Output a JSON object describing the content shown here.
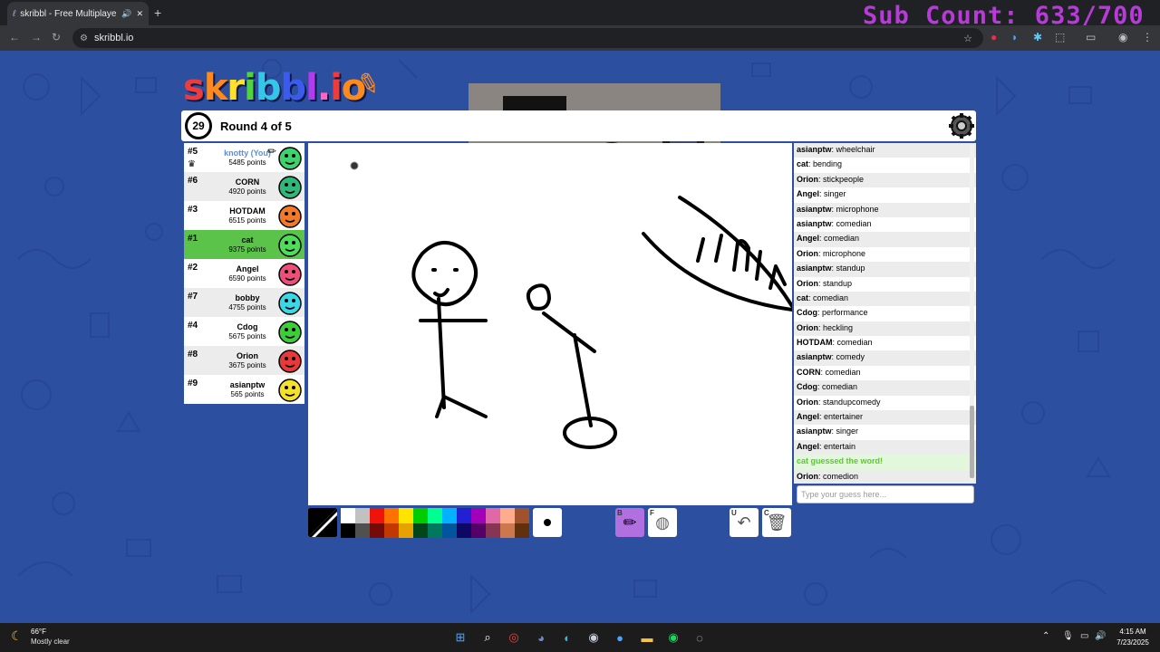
{
  "browser": {
    "tab_title": "skribbl - Free Multiplayer D",
    "url": "skribbl.io",
    "new_tab": "+",
    "close_tab": "✕"
  },
  "overlay": {
    "sub_count": "Sub Count: 633/700"
  },
  "game": {
    "logo": [
      "s",
      "k",
      "r",
      "i",
      "b",
      "b",
      "l",
      ".",
      "i",
      "o"
    ],
    "logo_colors": [
      "#ef3b3b",
      "#ff8a1c",
      "#ffe02b",
      "#4fd43b",
      "#34c6e8",
      "#3b5bef",
      "#b33bef",
      "#ff66c4",
      "#ef3b3b",
      "#ff8a1c"
    ],
    "timer": "29",
    "round": "Round 4 of 5"
  },
  "players": [
    {
      "rank": "#5",
      "name": "knotty (You)",
      "points": "5485 points",
      "color": "#3ed36a",
      "you": true,
      "drawing": true
    },
    {
      "rank": "#6",
      "name": "CORN",
      "points": "4920 points",
      "color": "#2fb87a"
    },
    {
      "rank": "#3",
      "name": "HOTDAM",
      "points": "6515 points",
      "color": "#f07a2a"
    },
    {
      "rank": "#1",
      "name": "cat",
      "points": "9375 points",
      "color": "#4fdc5a",
      "guessed": true
    },
    {
      "rank": "#2",
      "name": "Angel",
      "points": "6590 points",
      "color": "#ee4f7a"
    },
    {
      "rank": "#7",
      "name": "bobby",
      "points": "4755 points",
      "color": "#3ad8e6"
    },
    {
      "rank": "#4",
      "name": "Cdog",
      "points": "5675 points",
      "color": "#3dcc3a"
    },
    {
      "rank": "#8",
      "name": "Orion",
      "points": "3675 points",
      "color": "#e83838"
    },
    {
      "rank": "#9",
      "name": "asianptw",
      "points": "565 points",
      "color": "#f5e12a"
    }
  ],
  "chat": [
    {
      "name": "asianptw",
      "text": "wheelchair"
    },
    {
      "name": "cat",
      "text": "bending"
    },
    {
      "name": "Orion",
      "text": "stickpeople"
    },
    {
      "name": "Angel",
      "text": "singer"
    },
    {
      "name": "asianptw",
      "text": "microphone"
    },
    {
      "name": "asianptw",
      "text": "comedian"
    },
    {
      "name": "Angel",
      "text": "comedian"
    },
    {
      "name": "Orion",
      "text": "microphone"
    },
    {
      "name": "asianptw",
      "text": "standup"
    },
    {
      "name": "Orion",
      "text": "standup"
    },
    {
      "name": "cat",
      "text": "comedian"
    },
    {
      "name": "Cdog",
      "text": "performance"
    },
    {
      "name": "Orion",
      "text": "heckling"
    },
    {
      "name": "HOTDAM",
      "text": "comedian"
    },
    {
      "name": "asianptw",
      "text": "comedy"
    },
    {
      "name": "CORN",
      "text": "comedian"
    },
    {
      "name": "Cdog",
      "text": "comedian"
    },
    {
      "name": "Orion",
      "text": "standupcomedy"
    },
    {
      "name": "Angel",
      "text": "entertainer"
    },
    {
      "name": "asianptw",
      "text": "singer"
    },
    {
      "name": "Angel",
      "text": "entertain"
    },
    {
      "system": "cat guessed the word!"
    },
    {
      "name": "Orion",
      "text": "comedion"
    }
  ],
  "guess_placeholder": "Type your guess here...",
  "palette": {
    "top": [
      "#ffffff",
      "#c1c1c1",
      "#ef130b",
      "#ff7100",
      "#ffe400",
      "#00cc00",
      "#00ff91",
      "#00b2ff",
      "#231fd3",
      "#a300ba",
      "#df69a7",
      "#ffac8e",
      "#a0522d"
    ],
    "bottom": [
      "#000000",
      "#505050",
      "#740b07",
      "#c23800",
      "#e8a200",
      "#004619",
      "#00785d",
      "#00569e",
      "#0e0865",
      "#550069",
      "#873554",
      "#cc774d",
      "#63300d"
    ]
  },
  "tools": {
    "brush_key": "B",
    "fill_key": "F",
    "undo_key": "U",
    "clear_key": "C"
  },
  "taskbar": {
    "temp": "66°F",
    "weather": "Mostly clear",
    "time": "4:15 AM",
    "date": "7/23/2025"
  }
}
